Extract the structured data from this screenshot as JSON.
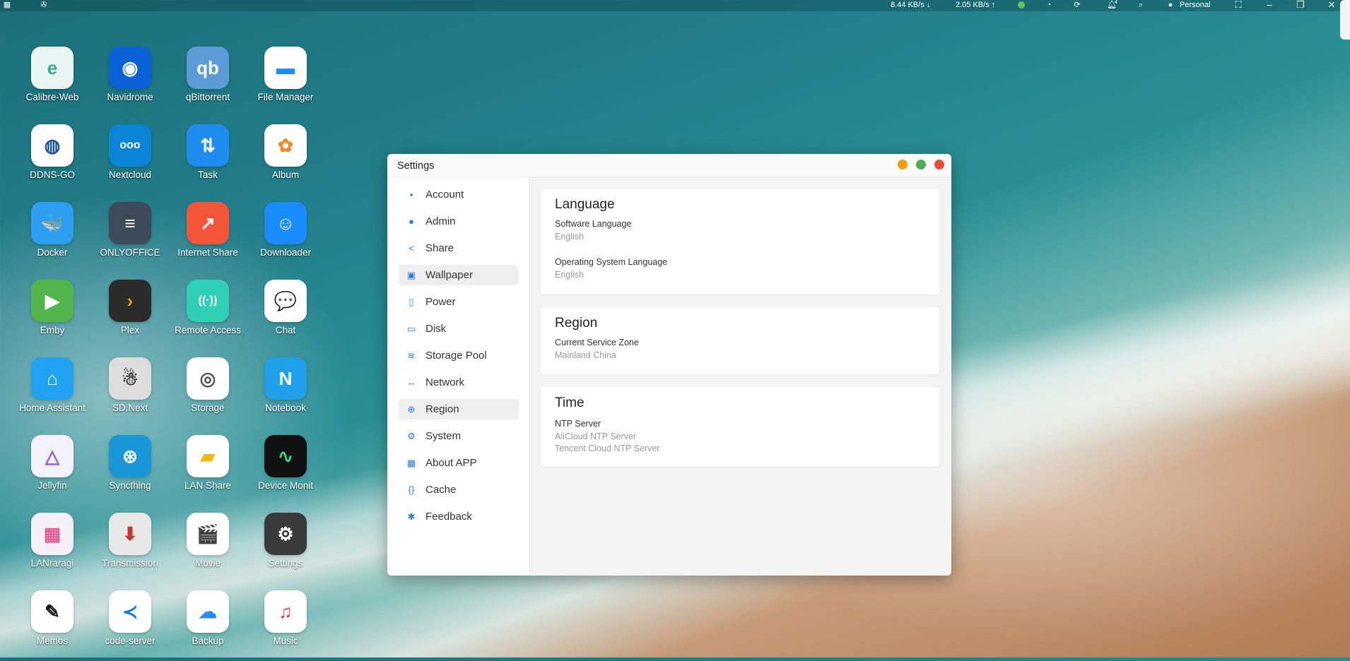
{
  "topbar": {
    "download_speed": "8.44 KB/s",
    "upload_speed": "2.05 KB/s",
    "notification_count": "4",
    "user": "Personal"
  },
  "apps": [
    {
      "label": "Calibre-Web",
      "icon": "calibre-icon",
      "color": "#e9f5f2",
      "fg": "#3aa98f",
      "glyph": "e"
    },
    {
      "label": "Navidrome",
      "icon": "navidrome-icon",
      "color": "#0b62d6",
      "fg": "#fff",
      "glyph": "◉"
    },
    {
      "label": "qBittorrent",
      "icon": "qbittorrent-icon",
      "color": "#5a9bd8",
      "fg": "#fff",
      "glyph": "qb"
    },
    {
      "label": "File Manager",
      "icon": "folder-icon",
      "color": "#ffffff",
      "fg": "#1a8cff",
      "glyph": "▬"
    },
    {
      "label": "DDNS-GO",
      "icon": "ddns-icon",
      "color": "#ffffff",
      "fg": "#1a4f9c",
      "glyph": "◍"
    },
    {
      "label": "Nextcloud",
      "icon": "nextcloud-icon",
      "color": "#0a84d6",
      "fg": "#fff",
      "glyph": "ooo"
    },
    {
      "label": "Task",
      "icon": "task-icon",
      "color": "#1f8df0",
      "fg": "#fff",
      "glyph": "⇅"
    },
    {
      "label": "Album",
      "icon": "album-icon",
      "color": "#ffffff",
      "fg": "#f08a2b",
      "glyph": "✿"
    },
    {
      "label": "Docker",
      "icon": "docker-icon",
      "color": "#2d9ff0",
      "fg": "#fff",
      "glyph": "🐳"
    },
    {
      "label": "ONLYOFFICE",
      "icon": "onlyoffice-icon",
      "color": "#3c4a5c",
      "fg": "#fff",
      "glyph": "≡"
    },
    {
      "label": "Internet Share",
      "icon": "internet-share-icon",
      "color": "#f2553a",
      "fg": "#fff",
      "glyph": "↗"
    },
    {
      "label": "Downloader",
      "icon": "downloader-icon",
      "color": "#1a8cff",
      "fg": "#fff",
      "glyph": "☺"
    },
    {
      "label": "Emby",
      "icon": "emby-icon",
      "color": "#52b54b",
      "fg": "#fff",
      "glyph": "▶"
    },
    {
      "label": "Plex",
      "icon": "plex-icon",
      "color": "#2b2b2b",
      "fg": "#e5a00d",
      "glyph": "›"
    },
    {
      "label": "Remote Access",
      "icon": "remote-access-icon",
      "color": "#2fd0b5",
      "fg": "#fff",
      "glyph": "((·))"
    },
    {
      "label": "Chat",
      "icon": "chat-icon",
      "color": "#ffffff",
      "fg": "#2a8cf0",
      "glyph": "💬"
    },
    {
      "label": "Home Assistant",
      "icon": "home-assistant-icon",
      "color": "#1fa3f0",
      "fg": "#fff",
      "glyph": "⌂"
    },
    {
      "label": "SD.Next",
      "icon": "sdnext-icon",
      "color": "#dddddd",
      "fg": "#333",
      "glyph": "☃"
    },
    {
      "label": "Storage",
      "icon": "storage-icon",
      "color": "#ffffff",
      "fg": "#555",
      "glyph": "◎"
    },
    {
      "label": "Notebook",
      "icon": "notebook-icon",
      "color": "#1fa0e8",
      "fg": "#fff",
      "glyph": "N"
    },
    {
      "label": "Jellyfin",
      "icon": "jellyfin-icon",
      "color": "#f3f1fb",
      "fg": "#8d5cd6",
      "glyph": "△"
    },
    {
      "label": "Syncthing",
      "icon": "syncthing-icon",
      "color": "#1996d6",
      "fg": "#fff",
      "glyph": "⊛"
    },
    {
      "label": "LAN Share",
      "icon": "lan-share-icon",
      "color": "#ffffff",
      "fg": "#f5b800",
      "glyph": "▰"
    },
    {
      "label": "Device Monit",
      "icon": "device-monitor-icon",
      "color": "#111111",
      "fg": "#34d399",
      "glyph": "∿"
    },
    {
      "label": "LANraragi",
      "icon": "lanraragi-icon",
      "color": "#f5f0f8",
      "fg": "#e05c9a",
      "glyph": "▦"
    },
    {
      "label": "Transmission",
      "icon": "transmission-icon",
      "color": "#e8e8e8",
      "fg": "#c0392b",
      "glyph": "⬇"
    },
    {
      "label": "Movie",
      "icon": "movie-icon",
      "color": "#ffffff",
      "fg": "#111",
      "glyph": "🎬"
    },
    {
      "label": "Settings",
      "icon": "settings-gear-icon",
      "color": "#3a3a3a",
      "fg": "#fff",
      "glyph": "⚙"
    },
    {
      "label": "Memos",
      "icon": "memos-icon",
      "color": "#ffffff",
      "fg": "#111",
      "glyph": "✎"
    },
    {
      "label": "code-server",
      "icon": "vscode-icon",
      "color": "#ffffff",
      "fg": "#0a7ad6",
      "glyph": "≺"
    },
    {
      "label": "Backup",
      "icon": "backup-icon",
      "color": "#ffffff",
      "fg": "#2a8cf0",
      "glyph": "☁"
    },
    {
      "label": "Music",
      "icon": "music-icon",
      "color": "#ffffff",
      "fg": "#f0384f",
      "glyph": "♫"
    }
  ],
  "window": {
    "title": "Settings",
    "nav": [
      {
        "label": "Account",
        "icon": "account-icon",
        "glyph": "▪"
      },
      {
        "label": "Admin",
        "icon": "admin-icon",
        "glyph": "●"
      },
      {
        "label": "Share",
        "icon": "share-icon",
        "glyph": "<"
      },
      {
        "label": "Wallpaper",
        "icon": "wallpaper-icon",
        "glyph": "▣"
      },
      {
        "label": "Power",
        "icon": "power-icon",
        "glyph": "▯"
      },
      {
        "label": "Disk",
        "icon": "disk-icon",
        "glyph": "▭"
      },
      {
        "label": "Storage Pool",
        "icon": "storage-pool-icon",
        "glyph": "≋"
      },
      {
        "label": "Network",
        "icon": "network-icon",
        "glyph": "↔"
      },
      {
        "label": "Region",
        "icon": "globe-icon",
        "glyph": "⊕"
      },
      {
        "label": "System",
        "icon": "gear-icon",
        "glyph": "⚙"
      },
      {
        "label": "About APP",
        "icon": "grid-icon",
        "glyph": "▦"
      },
      {
        "label": "Cache",
        "icon": "cache-icon",
        "glyph": "{}"
      },
      {
        "label": "Feedback",
        "icon": "feedback-icon",
        "glyph": "✱"
      }
    ],
    "language": {
      "heading": "Language",
      "software_label": "Software Language",
      "software_value": "English",
      "os_label": "Operating System Language",
      "os_value": "English"
    },
    "region": {
      "heading": "Region",
      "zone_label": "Current Service Zone",
      "zone_value": "Mainland China"
    },
    "time": {
      "heading": "Time",
      "ntp_label": "NTP Server",
      "ntp_values": [
        "AliCloud NTP Server",
        "Tencent Cloud NTP Server"
      ]
    }
  }
}
